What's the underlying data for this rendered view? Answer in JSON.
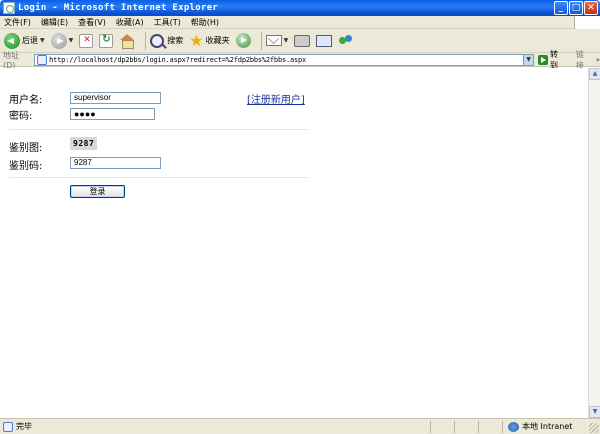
{
  "window": {
    "title": "Login - Microsoft Internet Explorer",
    "buttons": {
      "minimize": "_",
      "maximize": "□",
      "close": "✕"
    }
  },
  "menu": {
    "items": [
      "文件(F)",
      "编辑(E)",
      "查看(V)",
      "收藏(A)",
      "工具(T)",
      "帮助(H)"
    ]
  },
  "toolbar": {
    "back_label": "后退",
    "search_label": "搜索",
    "favorites_label": "收藏夹"
  },
  "address": {
    "label": "地址(D)",
    "url": "http://localhost/dp2bbs/login.aspx?redirect=%2fdp2bbs%2fbbs.aspx",
    "go_label": "转到",
    "links_label": "链接"
  },
  "form": {
    "username_label": "用户名:",
    "username_value": "supervisor",
    "password_label": "密码:",
    "password_dots": "●●●●",
    "register_link": "[注册新用户]",
    "captcha_label": "鉴别图:",
    "captcha_image_text": "9287",
    "code_label": "鉴别码:",
    "code_value": "9287",
    "submit_label": "登录"
  },
  "status": {
    "text": "完毕",
    "zone_text": "本地 Intranet"
  }
}
